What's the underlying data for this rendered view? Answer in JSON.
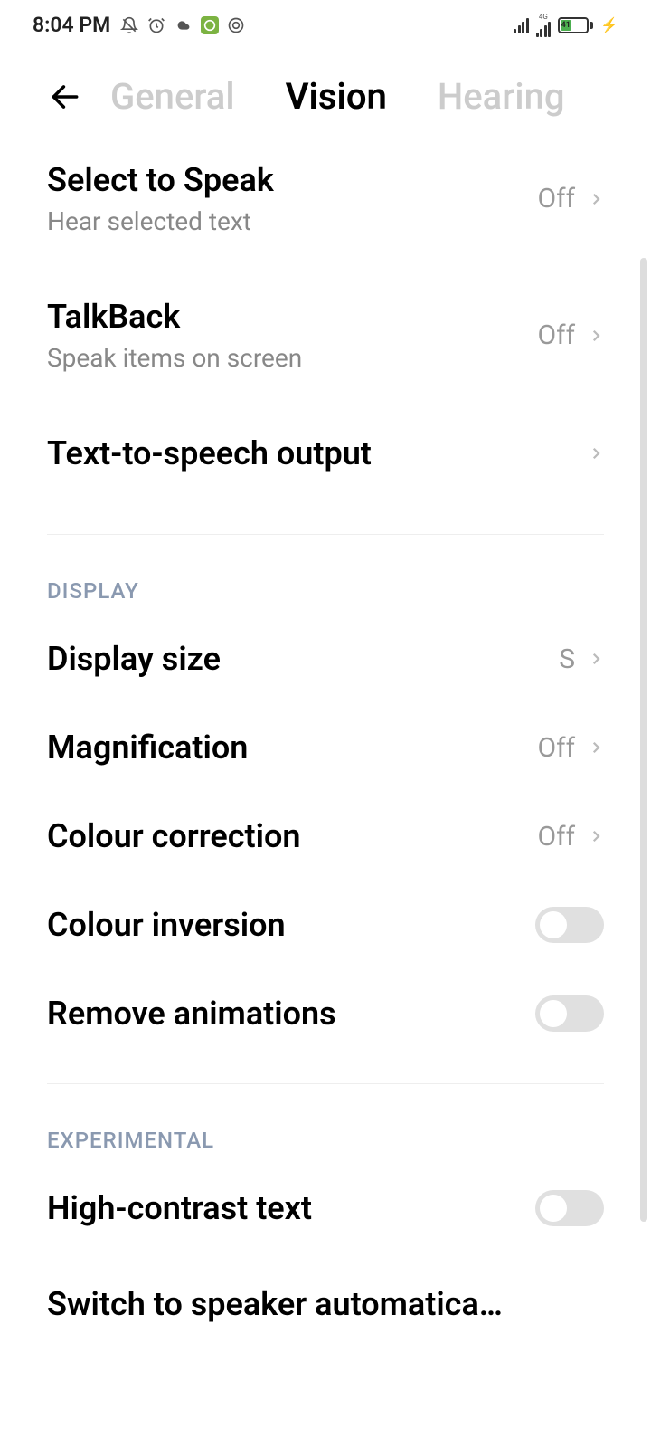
{
  "status": {
    "time": "8:04 PM",
    "battery": "41"
  },
  "tabs": {
    "general": "General",
    "vision": "Vision",
    "hearing": "Hearing"
  },
  "items": {
    "select_to_speak": {
      "title": "Select to Speak",
      "sub": "Hear selected text",
      "value": "Off"
    },
    "talkback": {
      "title": "TalkBack",
      "sub": "Speak items on screen",
      "value": "Off"
    },
    "tts": {
      "title": "Text-to-speech output"
    },
    "display_size": {
      "title": "Display size",
      "value": "S"
    },
    "magnification": {
      "title": "Magnification",
      "value": "Off"
    },
    "colour_correction": {
      "title": "Colour correction",
      "value": "Off"
    },
    "colour_inversion": {
      "title": "Colour inversion"
    },
    "remove_animations": {
      "title": "Remove animations"
    },
    "high_contrast": {
      "title": "High-contrast text"
    },
    "switch_speaker": {
      "title": "Switch to speaker automatica…"
    }
  },
  "sections": {
    "display": "DISPLAY",
    "experimental": "EXPERIMENTAL"
  }
}
